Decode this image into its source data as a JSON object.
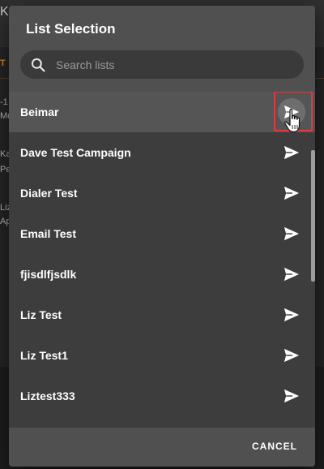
{
  "background": {
    "fragments": [
      "K",
      "T",
      "-1",
      "Mo",
      "Ka",
      "Per",
      "Liz",
      "Ap"
    ]
  },
  "dialog": {
    "title": "List Selection",
    "search": {
      "placeholder": "Search lists",
      "value": ""
    },
    "items": [
      {
        "label": "Beimar",
        "hovered": true
      },
      {
        "label": "Dave Test Campaign"
      },
      {
        "label": "Dialer Test"
      },
      {
        "label": "Email Test"
      },
      {
        "label": "fjisdlfjsdlk"
      },
      {
        "label": "Liz Test"
      },
      {
        "label": "Liz Test1"
      },
      {
        "label": "Liztest333"
      }
    ],
    "item_action_icon": "send-icon",
    "cancel_label": "CANCEL"
  },
  "colors": {
    "dialog_bg": "#3d3d3d",
    "header_bg": "#505050",
    "highlight_row": "#555555",
    "callout_red": "#e0393f"
  }
}
